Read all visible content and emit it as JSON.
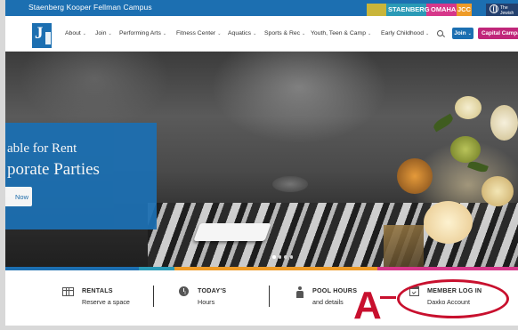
{
  "topbar": {
    "campus": "Staenberg Kooper Fellman Campus",
    "brand_words": [
      "STAENBERG",
      "OMAHA",
      "JCC"
    ],
    "lang_text": "The Jewish Fed"
  },
  "nav": {
    "items": [
      {
        "label": "About"
      },
      {
        "label": "Join"
      },
      {
        "label": "Performing Arts"
      },
      {
        "label": "Fitness Center"
      },
      {
        "label": "Aquatics"
      },
      {
        "label": "Sports & Rec"
      },
      {
        "label": "Youth, Teen & Camp"
      },
      {
        "label": "Early Childhood"
      }
    ],
    "chevron": "⌄",
    "join_button": "Join",
    "capital_button": "Capital Campaign"
  },
  "hero": {
    "line1": "able for Rent",
    "line2": "porate Parties",
    "button": "Now",
    "dots": 4,
    "active_dot": 0
  },
  "stripe_colors": [
    "#1c6fb1",
    "#2a9ab6",
    "#ee9b27",
    "#d6378a",
    "#c9b53a"
  ],
  "info": {
    "rentals": {
      "title": "RENTALS",
      "sub": "Reserve a space"
    },
    "today": {
      "title": "TODAY'S",
      "sub": "Hours"
    },
    "pool": {
      "title": "POOL HOURS",
      "sub": "and details"
    },
    "member": {
      "title": "MEMBER LOG IN",
      "sub": "Daxko Account"
    }
  },
  "annotation": {
    "letter": "A",
    "color": "#c8102e"
  },
  "colors": {
    "brand_blue": "#1c6fb1",
    "campaign_magenta": "#c0267a"
  }
}
